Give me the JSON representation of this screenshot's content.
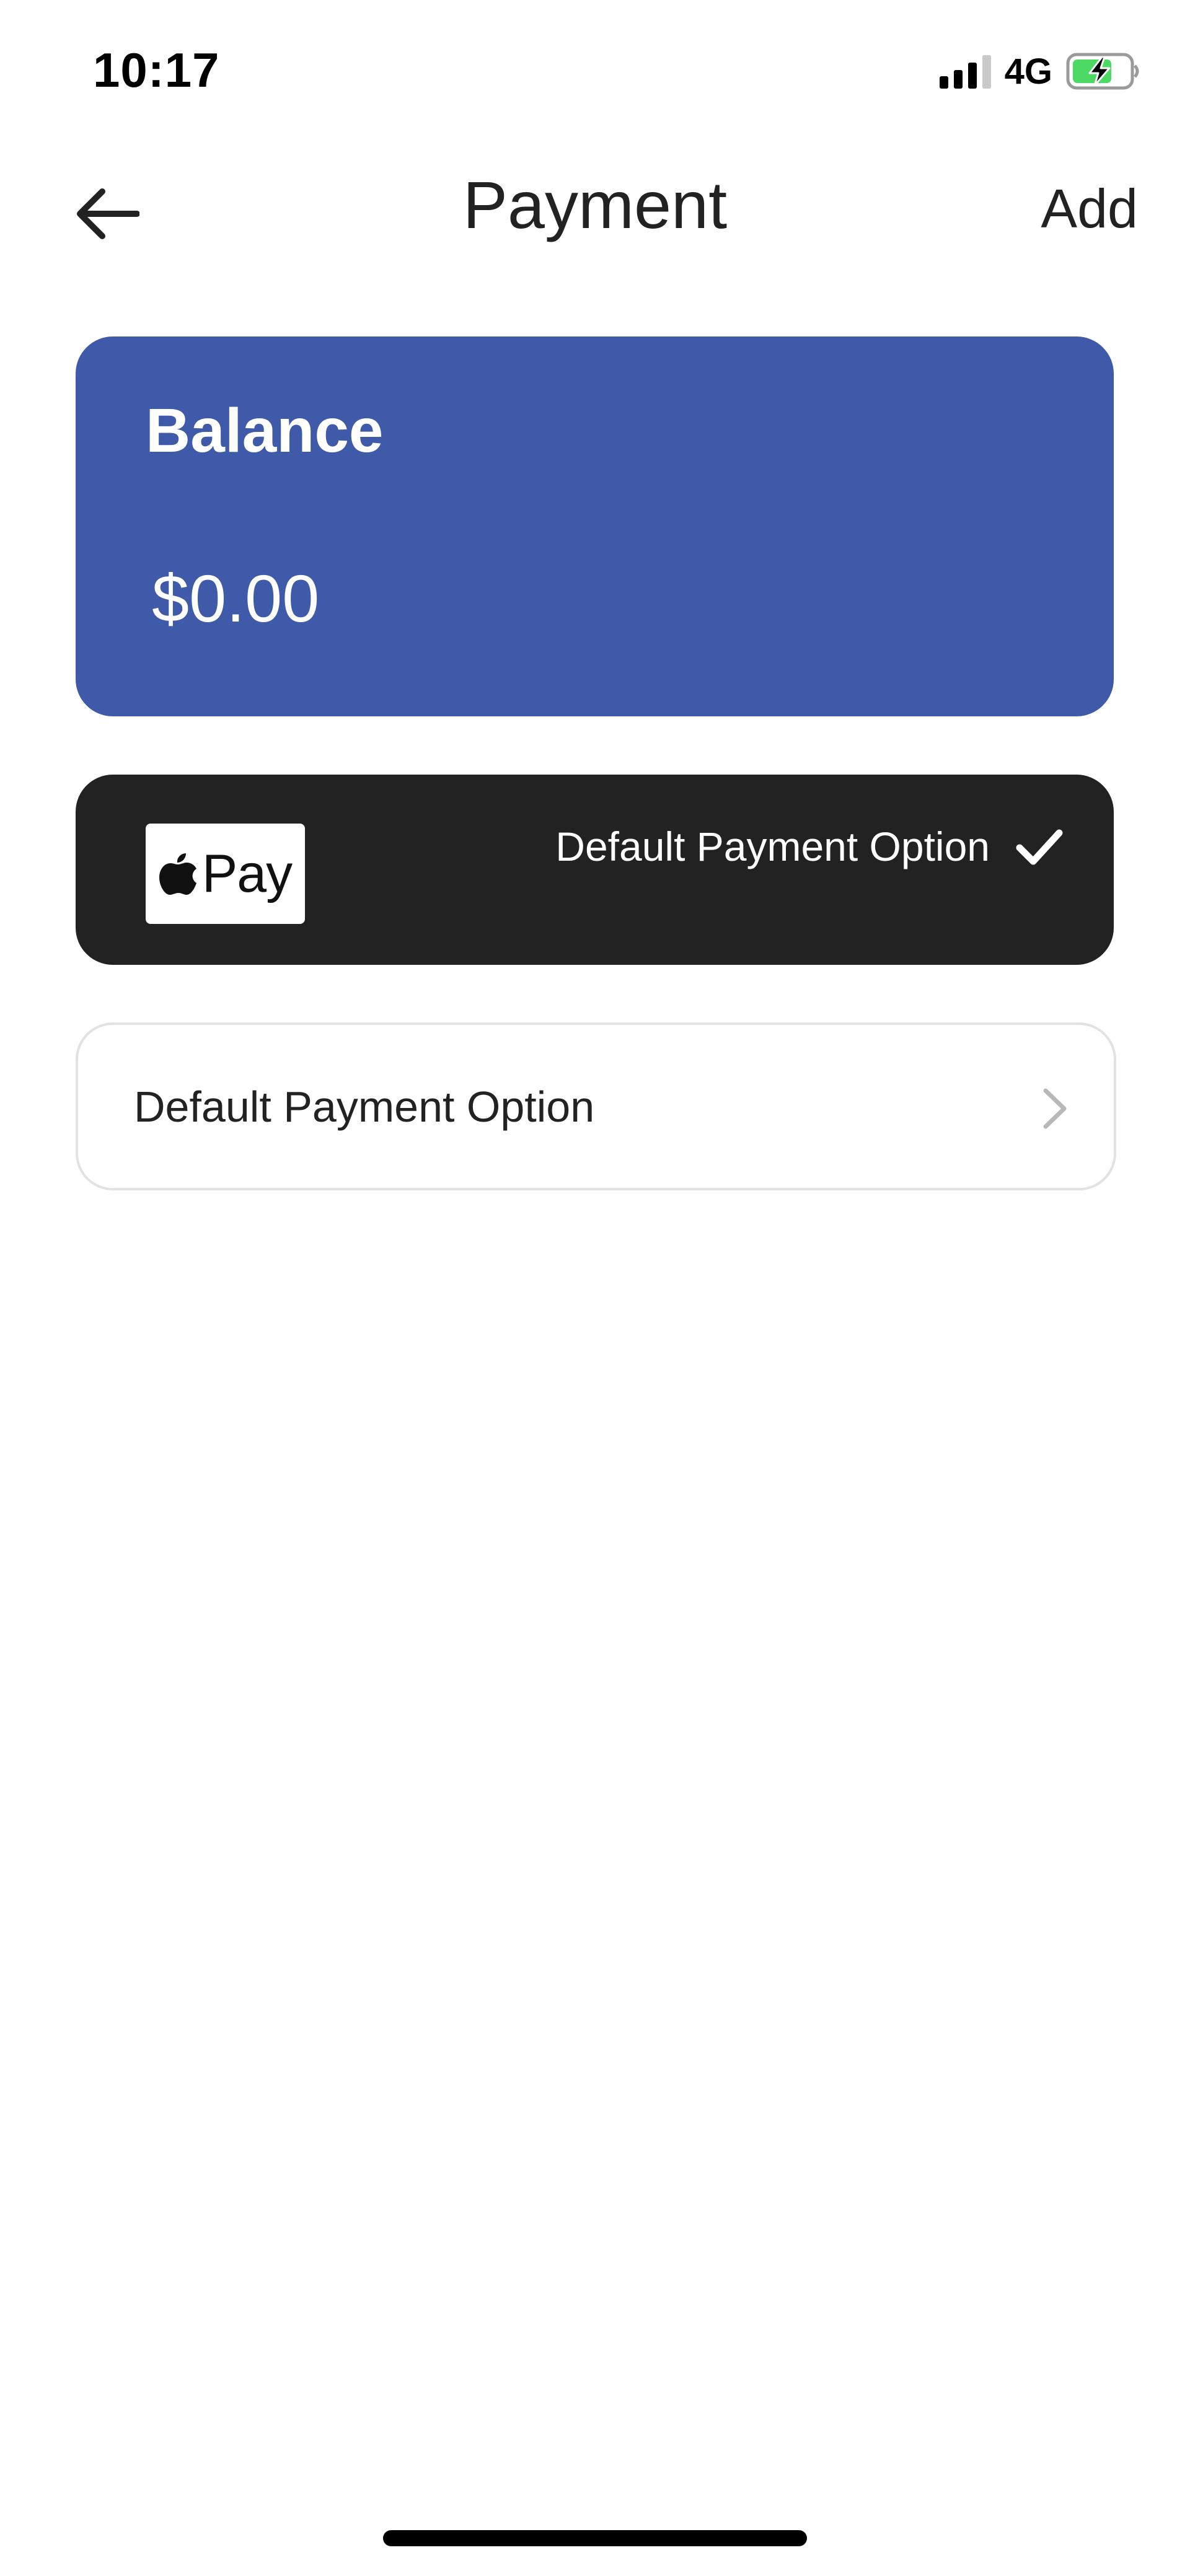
{
  "status_bar": {
    "time": "10:17",
    "network": "4G",
    "battery_color": "#4cd964",
    "signal_bars": 3
  },
  "nav": {
    "title": "Payment",
    "back_icon": "arrow-left-icon",
    "add_label": "Add"
  },
  "balance": {
    "label": "Balance",
    "amount": "$0.00",
    "color": "#3e5aa9"
  },
  "apple_pay": {
    "badge_text": "Pay",
    "default_label": "Default Payment Option",
    "check_icon": "checkmark-icon",
    "color": "#222222"
  },
  "option_row": {
    "label": "Default Payment Option",
    "chevron_icon": "chevron-right-icon"
  }
}
